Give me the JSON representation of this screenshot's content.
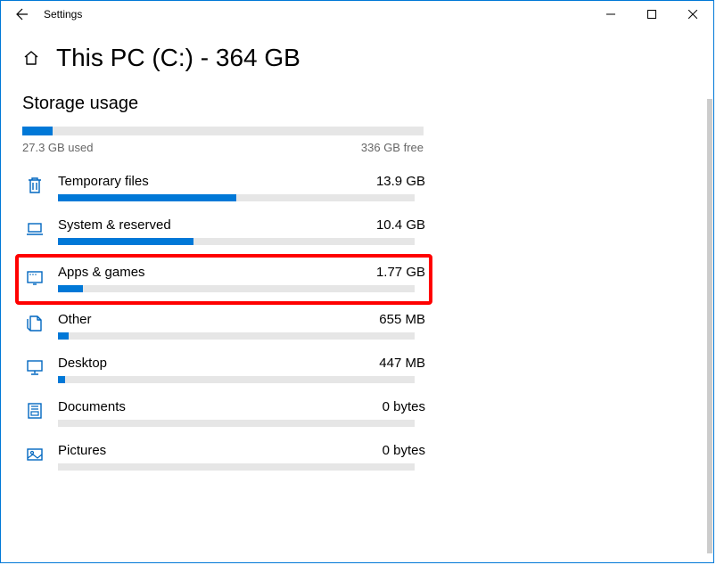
{
  "window": {
    "app_name": "Settings"
  },
  "header": {
    "title": "This PC (C:) - 364 GB"
  },
  "section_title": "Storage usage",
  "overall": {
    "used_label": "27.3 GB used",
    "free_label": "336 GB free",
    "fill_percent": 7.5
  },
  "categories": [
    {
      "id": "temp",
      "icon": "trash-icon",
      "name": "Temporary files",
      "size": "13.9 GB",
      "fill_percent": 50,
      "highlight": false
    },
    {
      "id": "system",
      "icon": "laptop-icon",
      "name": "System & reserved",
      "size": "10.4 GB",
      "fill_percent": 38,
      "highlight": false
    },
    {
      "id": "apps",
      "icon": "apps-icon",
      "name": "Apps & games",
      "size": "1.77 GB",
      "fill_percent": 7,
      "highlight": true
    },
    {
      "id": "other",
      "icon": "page-icon",
      "name": "Other",
      "size": "655 MB",
      "fill_percent": 3,
      "highlight": false
    },
    {
      "id": "desktop",
      "icon": "monitor-icon",
      "name": "Desktop",
      "size": "447 MB",
      "fill_percent": 2,
      "highlight": false
    },
    {
      "id": "docs",
      "icon": "document-icon",
      "name": "Documents",
      "size": "0 bytes",
      "fill_percent": 0,
      "highlight": false
    },
    {
      "id": "pics",
      "icon": "picture-icon",
      "name": "Pictures",
      "size": "0 bytes",
      "fill_percent": 0,
      "highlight": false
    }
  ],
  "colors": {
    "accent": "#0078d7",
    "icon": "#0067c0",
    "bar_bg": "#e6e6e6",
    "highlight": "#ff0000"
  }
}
